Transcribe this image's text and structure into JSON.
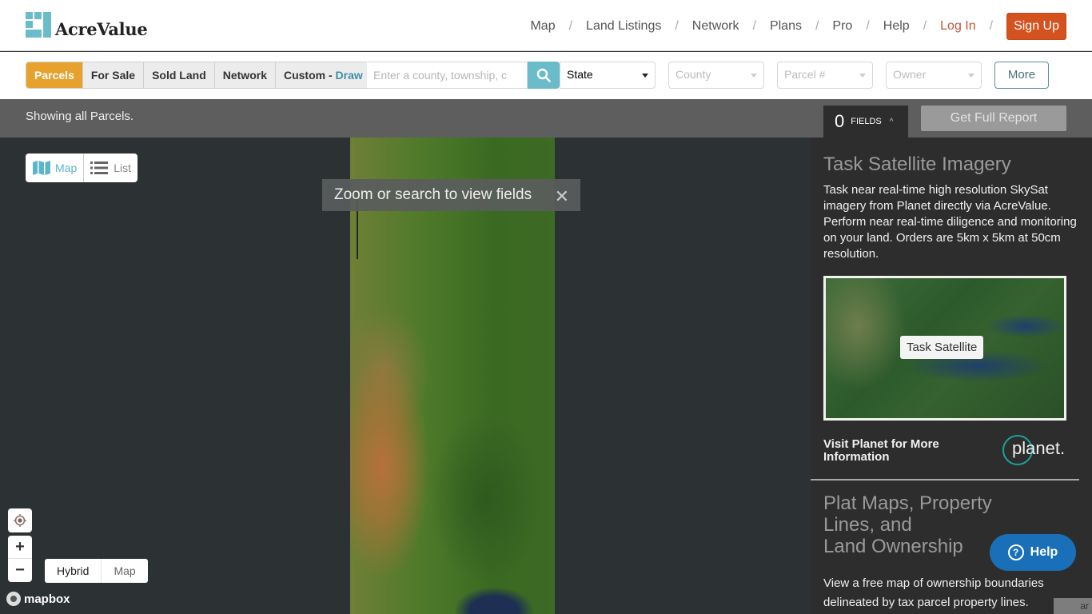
{
  "header": {
    "brand": "AcreValue",
    "nav": [
      {
        "label": "Map"
      },
      {
        "label": "Land Listings"
      },
      {
        "label": "Network"
      },
      {
        "label": "Plans"
      },
      {
        "label": "Pro"
      },
      {
        "label": "Help"
      },
      {
        "label": "Log In"
      }
    ],
    "separator": "/",
    "signup": "Sign Up"
  },
  "filters": {
    "segments": [
      {
        "label": "Parcels",
        "active": true
      },
      {
        "label": "For Sale"
      },
      {
        "label": "Sold Land"
      },
      {
        "label": "Network"
      }
    ],
    "custom_label": "Custom - ",
    "draw_label": "Draw",
    "search_placeholder": "Enter a county, township, c",
    "state": "State",
    "county": "County",
    "parcel": "Parcel #",
    "owner": "Owner",
    "more": "More"
  },
  "status": {
    "text": "Showing all Parcels.",
    "fields_count": "0",
    "fields_label": "FIELDS",
    "fields_caret": "^",
    "report_button": "Get Full Report"
  },
  "map": {
    "toast": "Zoom or search to view fields",
    "toast_close": "✕",
    "view_map": "Map",
    "view_list": "List",
    "zoom_in": "+",
    "zoom_out": "−",
    "basemap_hybrid": "Hybrid",
    "basemap_map": "Map",
    "attribution_brand": "mapbox",
    "attribution_tail": "ar"
  },
  "panel": {
    "sat_title": "Task Satellite Imagery",
    "sat_body": "Task near real-time high resolution SkySat imagery from Planet directly via AcreValue. Perform near real-time diligence and monitoring on your land. Orders are 5km x 5km at 50cm resolution.",
    "task_button": "Task Satellite",
    "visit_link": "Visit Planet for More Information",
    "planet_logo": "planet.",
    "plat_title_1": "Plat Maps, Property",
    "plat_title_2": "Lines, and",
    "plat_title_3": "Land Ownership",
    "plat_body": "View a free map of ownership boundaries delineated by tax parcel property lines."
  },
  "help": {
    "label": "Help",
    "icon": "?"
  },
  "colors": {
    "brand_teal": "#6bbccb",
    "signup_orange": "#d4521f",
    "parcels_active": "#e6a22d",
    "help_blue": "#1a70b8"
  }
}
